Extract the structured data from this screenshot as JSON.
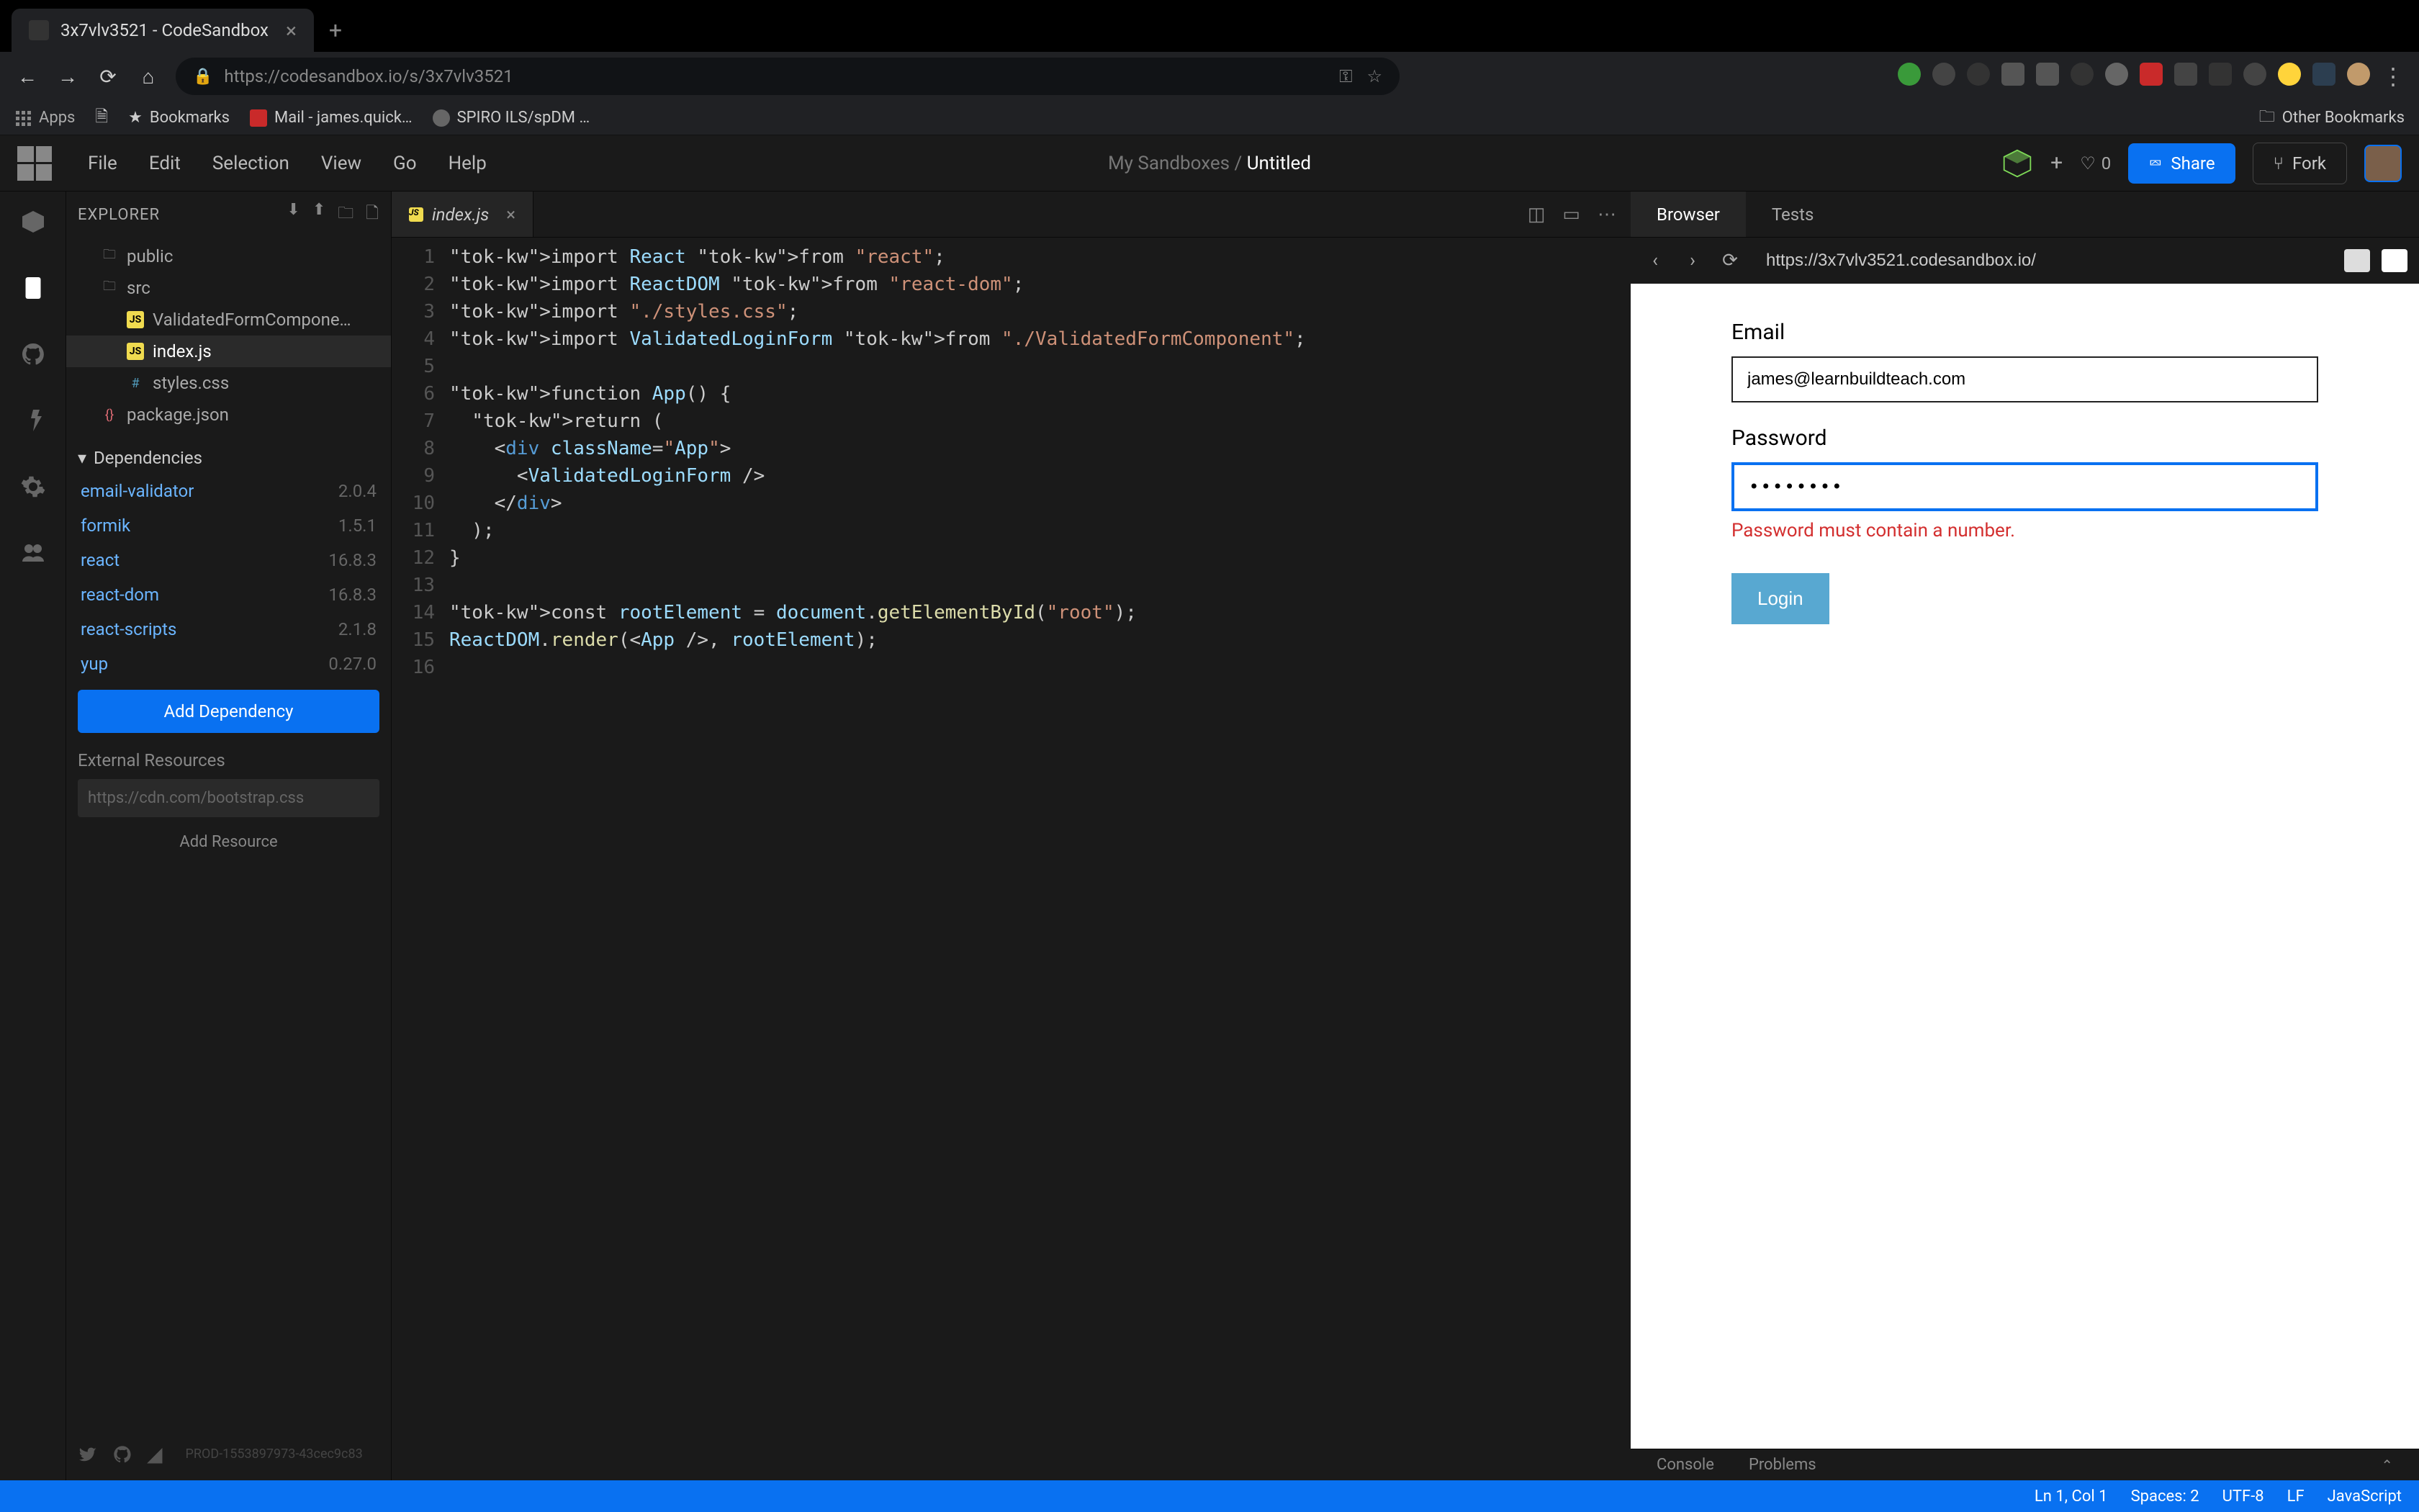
{
  "browser": {
    "tab_title": "3x7vlv3521 - CodeSandbox",
    "url": "https://codesandbox.io/s/3x7vlv3521",
    "bookmarks": {
      "apps": "Apps",
      "bookmarks": "Bookmarks",
      "mail": "Mail - james.quick…",
      "spiro": "SPIRO ILS/spDM …",
      "other": "Other Bookmarks"
    }
  },
  "menubar": {
    "file": "File",
    "edit": "Edit",
    "selection": "Selection",
    "view": "View",
    "go": "Go",
    "help": "Help",
    "breadcrumb_prefix": "My Sandboxes /",
    "breadcrumb_name": "Untitled",
    "likes": "0",
    "share": "Share",
    "fork": "Fork"
  },
  "sidebar": {
    "title": "EXPLORER",
    "files": {
      "public": "public",
      "src": "src",
      "validated": "ValidatedFormCompone…",
      "index": "index.js",
      "styles": "styles.css",
      "package": "package.json"
    },
    "deps_title": "Dependencies",
    "deps": [
      {
        "name": "email-validator",
        "ver": "2.0.4"
      },
      {
        "name": "formik",
        "ver": "1.5.1"
      },
      {
        "name": "react",
        "ver": "16.8.3"
      },
      {
        "name": "react-dom",
        "ver": "16.8.3"
      },
      {
        "name": "react-scripts",
        "ver": "2.1.8"
      },
      {
        "name": "yup",
        "ver": "0.27.0"
      }
    ],
    "add_dep": "Add Dependency",
    "ext_res": "External Resources",
    "res_placeholder": "https://cdn.com/bootstrap.css",
    "add_res": "Add Resource",
    "prod": "PROD-1553897973-43cec9c83"
  },
  "editor": {
    "tab_name": "index.js",
    "code_lines": [
      "import React from \"react\";",
      "import ReactDOM from \"react-dom\";",
      "import \"./styles.css\";",
      "import ValidatedLoginForm from \"./ValidatedFormComponent\";",
      "",
      "function App() {",
      "  return (",
      "    <div className=\"App\">",
      "      <ValidatedLoginForm />",
      "    </div>",
      "  );",
      "}",
      "",
      "const rootElement = document.getElementById(\"root\");",
      "ReactDOM.render(<App />, rootElement);",
      ""
    ]
  },
  "preview": {
    "tab_browser": "Browser",
    "tab_tests": "Tests",
    "url": "https://3x7vlv3521.codesandbox.io/",
    "email_label": "Email",
    "email_value": "james@learnbuildteach.com",
    "password_label": "Password",
    "password_value": "••••••••",
    "error": "Password must contain a number.",
    "login": "Login"
  },
  "bottom": {
    "console": "Console",
    "problems": "Problems"
  },
  "status": {
    "pos": "Ln 1, Col 1",
    "spaces": "Spaces: 2",
    "enc": "UTF-8",
    "eol": "LF",
    "lang": "JavaScript"
  }
}
